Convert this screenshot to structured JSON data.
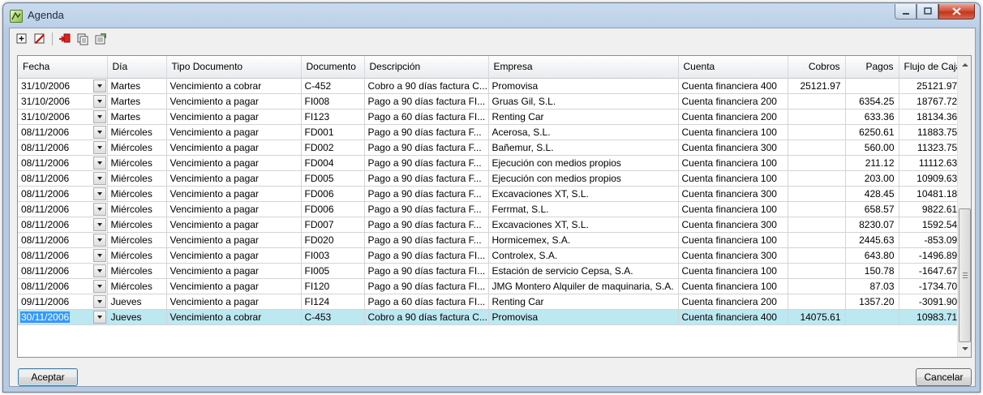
{
  "window": {
    "title": "Agenda"
  },
  "toolbar": {
    "icons": [
      "add-row-icon",
      "delete-row-icon",
      "import-icon",
      "copy-icon",
      "export-icon"
    ]
  },
  "grid": {
    "columns": [
      "Fecha",
      "Día",
      "Tipo Documento",
      "Documento",
      "Descripción",
      "Empresa",
      "Cuenta",
      "Cobros",
      "Pagos",
      "Flujo de Caja"
    ],
    "rows": [
      {
        "fecha": "31/10/2006",
        "dia": "Martes",
        "tipo": "Vencimiento a cobrar",
        "doc": "C-452",
        "desc": "Cobro a 90 días factura C...",
        "empresa": "Promovisa",
        "cuenta": "Cuenta financiera 400",
        "cobros": "25121.97",
        "pagos": "",
        "flujo": "25121.97"
      },
      {
        "fecha": "31/10/2006",
        "dia": "Martes",
        "tipo": "Vencimiento a pagar",
        "doc": "FI008",
        "desc": "Pago a 90 días factura FI...",
        "empresa": "Gruas Gil, S.L.",
        "cuenta": "Cuenta financiera 200",
        "cobros": "",
        "pagos": "6354.25",
        "flujo": "18767.72"
      },
      {
        "fecha": "31/10/2006",
        "dia": "Martes",
        "tipo": "Vencimiento a pagar",
        "doc": "FI123",
        "desc": "Pago a 60 días factura FI...",
        "empresa": "Renting Car",
        "cuenta": "Cuenta financiera 200",
        "cobros": "",
        "pagos": "633.36",
        "flujo": "18134.36"
      },
      {
        "fecha": "08/11/2006",
        "dia": "Miércoles",
        "tipo": "Vencimiento a pagar",
        "doc": "FD001",
        "desc": "Pago a 90 días factura F...",
        "empresa": "Acerosa, S.L.",
        "cuenta": "Cuenta financiera 100",
        "cobros": "",
        "pagos": "6250.61",
        "flujo": "11883.75"
      },
      {
        "fecha": "08/11/2006",
        "dia": "Miércoles",
        "tipo": "Vencimiento a pagar",
        "doc": "FD002",
        "desc": "Pago a 90 días factura F...",
        "empresa": "Bañemur, S.L.",
        "cuenta": "Cuenta financiera 300",
        "cobros": "",
        "pagos": "560.00",
        "flujo": "11323.75"
      },
      {
        "fecha": "08/11/2006",
        "dia": "Miércoles",
        "tipo": "Vencimiento a pagar",
        "doc": "FD004",
        "desc": "Pago a 90 días factura F...",
        "empresa": "Ejecución con medios propios",
        "cuenta": "Cuenta financiera 100",
        "cobros": "",
        "pagos": "211.12",
        "flujo": "11112.63"
      },
      {
        "fecha": "08/11/2006",
        "dia": "Miércoles",
        "tipo": "Vencimiento a pagar",
        "doc": "FD005",
        "desc": "Pago a 90 días factura F...",
        "empresa": "Ejecución con medios propios",
        "cuenta": "Cuenta financiera 100",
        "cobros": "",
        "pagos": "203.00",
        "flujo": "10909.63"
      },
      {
        "fecha": "08/11/2006",
        "dia": "Miércoles",
        "tipo": "Vencimiento a pagar",
        "doc": "FD006",
        "desc": "Pago a 90 días factura F...",
        "empresa": "Excavaciones XT, S.L.",
        "cuenta": "Cuenta financiera 300",
        "cobros": "",
        "pagos": "428.45",
        "flujo": "10481.18"
      },
      {
        "fecha": "08/11/2006",
        "dia": "Miércoles",
        "tipo": "Vencimiento a pagar",
        "doc": "FD006",
        "desc": "Pago a 90 días factura F...",
        "empresa": "Ferrmat, S.L.",
        "cuenta": "Cuenta financiera 100",
        "cobros": "",
        "pagos": "658.57",
        "flujo": "9822.61"
      },
      {
        "fecha": "08/11/2006",
        "dia": "Miércoles",
        "tipo": "Vencimiento a pagar",
        "doc": "FD007",
        "desc": "Pago a 90 días factura F...",
        "empresa": "Excavaciones XT, S.L.",
        "cuenta": "Cuenta financiera 300",
        "cobros": "",
        "pagos": "8230.07",
        "flujo": "1592.54"
      },
      {
        "fecha": "08/11/2006",
        "dia": "Miércoles",
        "tipo": "Vencimiento a pagar",
        "doc": "FD020",
        "desc": "Pago a 90 días factura F...",
        "empresa": "Hormicemex, S.A.",
        "cuenta": "Cuenta financiera 100",
        "cobros": "",
        "pagos": "2445.63",
        "flujo": "-853.09"
      },
      {
        "fecha": "08/11/2006",
        "dia": "Miércoles",
        "tipo": "Vencimiento a pagar",
        "doc": "FI003",
        "desc": "Pago a 90 días factura FI...",
        "empresa": "Controlex, S.A.",
        "cuenta": "Cuenta financiera 300",
        "cobros": "",
        "pagos": "643.80",
        "flujo": "-1496.89"
      },
      {
        "fecha": "08/11/2006",
        "dia": "Miércoles",
        "tipo": "Vencimiento a pagar",
        "doc": "FI005",
        "desc": "Pago a 90 días factura FI...",
        "empresa": "Estación de servicio Cepsa, S.A.",
        "cuenta": "Cuenta financiera 100",
        "cobros": "",
        "pagos": "150.78",
        "flujo": "-1647.67"
      },
      {
        "fecha": "08/11/2006",
        "dia": "Miércoles",
        "tipo": "Vencimiento a pagar",
        "doc": "FI120",
        "desc": "Pago a 90 días factura FI...",
        "empresa": "JMG Montero Alquiler de maquinaria, S.A.",
        "cuenta": "Cuenta financiera 100",
        "cobros": "",
        "pagos": "87.03",
        "flujo": "-1734.70"
      },
      {
        "fecha": "09/11/2006",
        "dia": "Jueves",
        "tipo": "Vencimiento a pagar",
        "doc": "FI124",
        "desc": "Pago a 60 días factura FI...",
        "empresa": "Renting Car",
        "cuenta": "Cuenta financiera 200",
        "cobros": "",
        "pagos": "1357.20",
        "flujo": "-3091.90"
      },
      {
        "fecha": "30/11/2006",
        "dia": "Jueves",
        "tipo": "Vencimiento a cobrar",
        "doc": "C-453",
        "desc": "Cobro a 90 días factura C...",
        "empresa": "Promovisa",
        "cuenta": "Cuenta financiera 400",
        "cobros": "14075.61",
        "pagos": "",
        "flujo": "10983.71",
        "selected": true
      }
    ]
  },
  "buttons": {
    "accept": "Aceptar",
    "cancel": "Cancelar"
  },
  "colors": {
    "selected_row": "#bce8f1",
    "selected_text_bg": "#3399ff",
    "title_gradient": "#c9dbee",
    "close_button": "#c2351b"
  }
}
